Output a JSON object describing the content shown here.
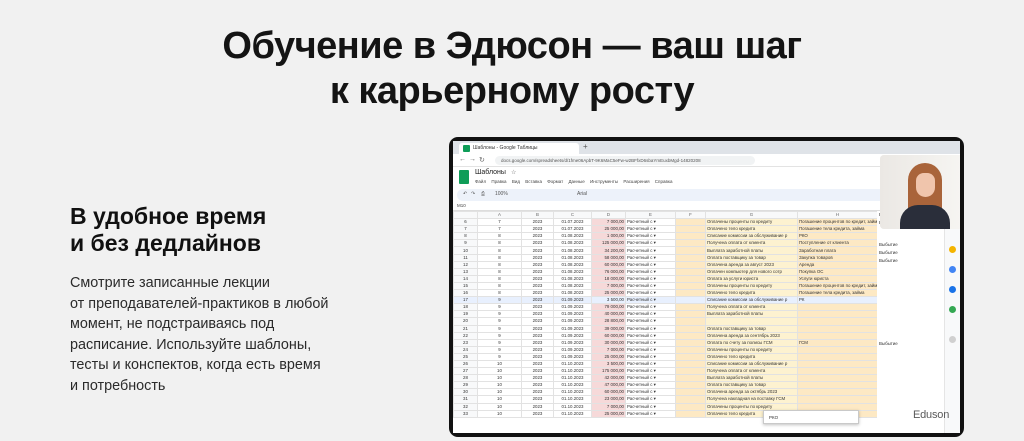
{
  "hero": {
    "title_line1": "Обучение в Эдюсон — ваш шаг",
    "title_line2": "к карьерному росту"
  },
  "feature": {
    "title_line1": "В удобное время",
    "title_line2": "и без дедлайнов",
    "text_lines": [
      "Смотрите записанные лекции",
      "от преподавателей-практиков в любой",
      "момент, не подстраиваясь под",
      "расписание. Используйте шаблоны,",
      "тесты и конспектов, когда есть время",
      "и потребность"
    ]
  },
  "video": {
    "browser_tab": "Шаблоны - Google Таблицы",
    "url": "docs.google.com/spreadsheets/d/1fme06ApbT-9K6MaC5eFw-w2BFfxD6sbaYmEuxbMgd-14820208",
    "doc_title": "Шаблоны",
    "menu": [
      "Файл",
      "Правка",
      "Вид",
      "Вставка",
      "Формат",
      "Данные",
      "Инструменты",
      "Расширения",
      "Справка"
    ],
    "toolbar_font": "Arial",
    "toolbar_zoom": "100%",
    "name_box": "M10",
    "col_headers": [
      "",
      "A",
      "B",
      "C",
      "D",
      "E",
      "F",
      "G",
      "H"
    ],
    "rows": [
      {
        "n": "6",
        "a": "7",
        "b": "2023",
        "c": "01.07.2023",
        "d": "7 000,00",
        "e": "Расчетный с ▾",
        "g": "Оплачены проценты по кредиту",
        "h": "Погашение процентов по кредит, займ"
      },
      {
        "n": "7",
        "a": "7",
        "b": "2023",
        "c": "01.07.2023",
        "d": "25 000,00",
        "e": "Расчетный с ▾",
        "g": "Оплачено тело кредита",
        "h": "Погашение тела кредита, займа"
      },
      {
        "n": "8",
        "a": "8",
        "b": "2023",
        "c": "01.08.2023",
        "d": "1 000,00",
        "e": "Расчетный с ▾",
        "g": "Списание комиссии за обслуживание р",
        "h": "РКО"
      },
      {
        "n": "9",
        "a": "8",
        "b": "2023",
        "c": "01.08.2023",
        "d": "125 000,00",
        "e": "Расчетный с ▾",
        "g": "Получена оплата от клиента",
        "h": "Поступление от клиента"
      },
      {
        "n": "10",
        "a": "8",
        "b": "2023",
        "c": "01.08.2023",
        "d": "34 200,00",
        "e": "Расчетный с ▾",
        "g": "Выплата заработной платы",
        "h": "Заработная плата"
      },
      {
        "n": "11",
        "a": "8",
        "b": "2023",
        "c": "01.08.2023",
        "d": "58 000,00",
        "e": "Расчетный с ▾",
        "g": "Оплата поставщику за товар",
        "h": "Закупка товаров"
      },
      {
        "n": "12",
        "a": "8",
        "b": "2023",
        "c": "01.08.2023",
        "d": "60 000,00",
        "e": "Расчетный с ▾",
        "g": "Оплачена аренда за август 2023",
        "h": "Аренда"
      },
      {
        "n": "13",
        "a": "8",
        "b": "2023",
        "c": "01.08.2023",
        "d": "76 000,00",
        "e": "Расчетный с ▾",
        "g": "Оплачен компьютер для нового сотр",
        "h": "Покупка ОС"
      },
      {
        "n": "14",
        "a": "8",
        "b": "2023",
        "c": "01.08.2023",
        "d": "18 000,00",
        "e": "Расчетный с ▾",
        "g": "Оплата за услуги юриста",
        "h": "Услуги юриста"
      },
      {
        "n": "15",
        "a": "8",
        "b": "2023",
        "c": "01.08.2023",
        "d": "7 000,00",
        "e": "Расчетный с ▾",
        "g": "Оплачены проценты по кредиту",
        "h": "Погашение процентов по кредит, займ"
      },
      {
        "n": "16",
        "a": "8",
        "b": "2023",
        "c": "01.08.2023",
        "d": "25 000,00",
        "e": "Расчетный с ▾",
        "g": "Оплачено тело кредита",
        "h": "Погашение тела кредита, займа"
      },
      {
        "n": "17",
        "a": "9",
        "b": "2023",
        "c": "01.09.2023",
        "d": "3 500,00",
        "e": "Расчетный с ▾",
        "g": "Списание комиссии за обслуживание р",
        "h": "РК"
      },
      {
        "n": "18",
        "a": "9",
        "b": "2023",
        "c": "01.09.2023",
        "d": "79 000,00",
        "e": "Расчетный с ▾",
        "g": "Получена оплата от клиента",
        "h": ""
      },
      {
        "n": "19",
        "a": "9",
        "b": "2023",
        "c": "01.09.2023",
        "d": "40 000,00",
        "e": "Расчетный с ▾",
        "g": "Выплата заработной платы",
        "h": ""
      },
      {
        "n": "20",
        "a": "9",
        "b": "2023",
        "c": "01.09.2023",
        "d": "28 800,00",
        "e": "Расчетный с ▾",
        "g": "",
        "h": ""
      },
      {
        "n": "21",
        "a": "9",
        "b": "2023",
        "c": "01.09.2023",
        "d": "39 000,00",
        "e": "Расчетный с ▾",
        "g": "Оплата поставщику за товар",
        "h": ""
      },
      {
        "n": "22",
        "a": "9",
        "b": "2023",
        "c": "01.09.2023",
        "d": "60 000,00",
        "e": "Расчетный с ▾",
        "g": "Оплачена аренда за сентябрь 2023",
        "h": ""
      },
      {
        "n": "23",
        "a": "9",
        "b": "2023",
        "c": "01.09.2023",
        "d": "30 000,00",
        "e": "Расчетный с ▾",
        "g": "Оплата по счету за полисы ГСМ",
        "h": "ГСМ"
      },
      {
        "n": "24",
        "a": "9",
        "b": "2023",
        "c": "01.09.2023",
        "d": "7 000,00",
        "e": "Расчетный с ▾",
        "g": "Оплачены проценты по кредиту",
        "h": ""
      },
      {
        "n": "25",
        "a": "9",
        "b": "2023",
        "c": "01.09.2023",
        "d": "25 000,00",
        "e": "Расчетный с ▾",
        "g": "Оплачено тело кредита",
        "h": ""
      },
      {
        "n": "26",
        "a": "10",
        "b": "2023",
        "c": "01.10.2023",
        "d": "3 500,00",
        "e": "Расчетный с ▾",
        "g": "Списание комиссии за обслуживание р",
        "h": ""
      },
      {
        "n": "27",
        "a": "10",
        "b": "2023",
        "c": "01.10.2023",
        "d": "175 000,00",
        "e": "Расчетный с ▾",
        "g": "Получена оплата от клиента",
        "h": ""
      },
      {
        "n": "28",
        "a": "10",
        "b": "2023",
        "c": "01.10.2023",
        "d": "42 000,00",
        "e": "Расчетный с ▾",
        "g": "Выплата заработной платы",
        "h": ""
      },
      {
        "n": "29",
        "a": "10",
        "b": "2023",
        "c": "01.10.2023",
        "d": "47 000,00",
        "e": "Расчетный с ▾",
        "g": "Оплата поставщику за товар",
        "h": ""
      },
      {
        "n": "30",
        "a": "10",
        "b": "2023",
        "c": "01.10.2023",
        "d": "60 000,00",
        "e": "Расчетный с ▾",
        "g": "Оплачена аренда за октябрь 2023",
        "h": ""
      },
      {
        "n": "31",
        "a": "10",
        "b": "2023",
        "c": "01.10.2023",
        "d": "23 000,00",
        "e": "Расчетный с ▾",
        "g": "Получена накладная на поставку ГСМ",
        "h": ""
      },
      {
        "n": "32",
        "a": "10",
        "b": "2023",
        "c": "01.10.2023",
        "d": "7 000,00",
        "e": "Расчетный с ▾",
        "g": "Оплачены проценты по кредиту",
        "h": ""
      },
      {
        "n": "33",
        "a": "10",
        "b": "2023",
        "c": "01.10.2023",
        "d": "25 000,00",
        "e": "Расчетный с ▾",
        "g": "Оплачено тело кредита",
        "h": ""
      }
    ],
    "right_col": [
      "Выбытие",
      "Выбытие",
      "",
      "",
      "Выбытие",
      "Выбытие",
      "Выбытие",
      "",
      "",
      "",
      "",
      "",
      "",
      "",
      "",
      "",
      "",
      "Выбытие"
    ],
    "dropdown_text": "РКО",
    "watermark": "Eduson"
  }
}
